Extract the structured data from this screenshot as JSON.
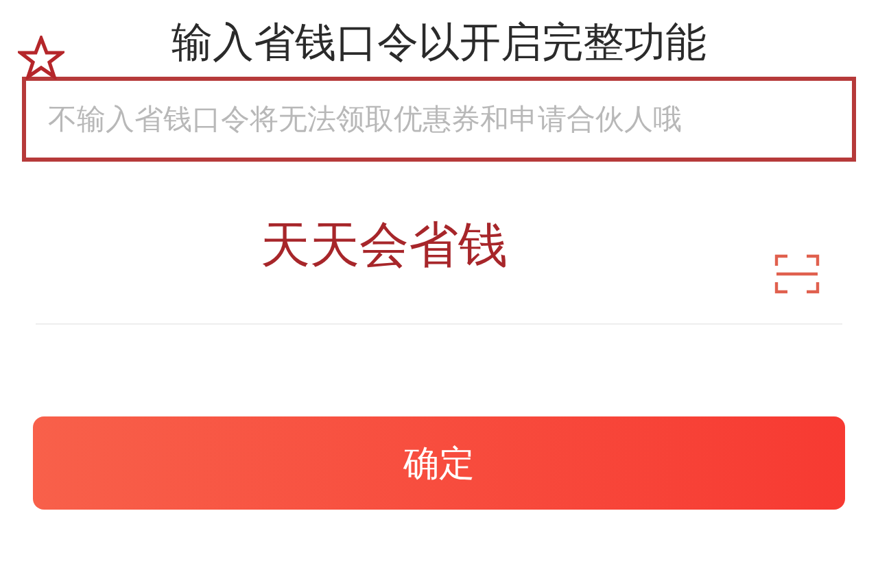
{
  "title": "输入省钱口令以开启完整功能",
  "notice": "不输入省钱口令将无法领取优惠券和申请合伙人哦",
  "code_field": {
    "value": "天天会省钱"
  },
  "confirm_button": {
    "label": "确定"
  }
}
